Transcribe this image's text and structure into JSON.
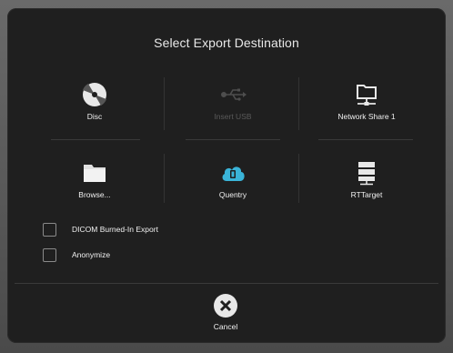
{
  "dialog": {
    "title": "Select Export Destination"
  },
  "destinations": [
    {
      "label": "Disc",
      "icon": "disc-icon",
      "enabled": true
    },
    {
      "label": "Insert USB",
      "icon": "usb-icon",
      "enabled": false
    },
    {
      "label": "Network Share 1",
      "icon": "network-share-icon",
      "enabled": true
    },
    {
      "label": "Browse...",
      "icon": "folder-icon",
      "enabled": true
    },
    {
      "label": "Quentry",
      "icon": "cloud-icon",
      "enabled": true
    },
    {
      "label": "RTTarget",
      "icon": "server-icon",
      "enabled": true
    }
  ],
  "options": [
    {
      "label": "DICOM Burned-In Export",
      "checked": false
    },
    {
      "label": "Anonymize",
      "checked": false
    }
  ],
  "cancel": {
    "label": "Cancel",
    "icon": "close-circle-icon"
  },
  "colors": {
    "background": "#1f1f1f",
    "text": "#f0f0f0",
    "disabled_text": "#5a5a5a",
    "cloud_accent": "#3ab4d8"
  }
}
